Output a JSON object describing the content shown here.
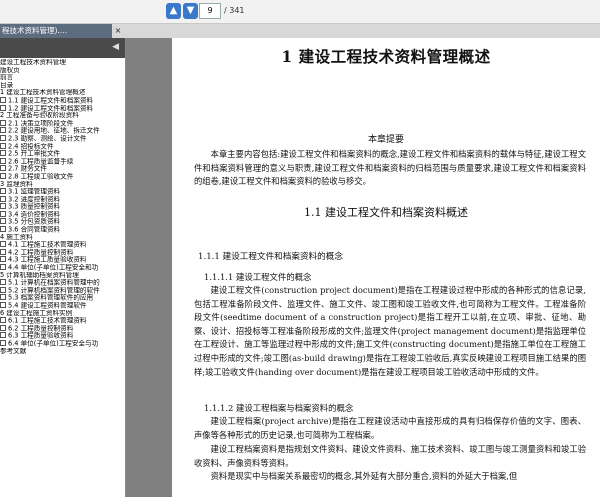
{
  "toolbar": {
    "page_current": "9",
    "page_total": "/ 341",
    "prev_icon": "arrow-up-icon",
    "next_icon": "arrow-down-icon"
  },
  "tab": {
    "title": "程技术资料管理)....",
    "close": "×"
  },
  "sidebar": {
    "toggle": "◀",
    "outline": [
      {
        "label": "建设工程技术资料管理",
        "box": false
      },
      {
        "label": "版权页",
        "box": false
      },
      {
        "label": "前言",
        "box": false
      },
      {
        "label": "目录",
        "box": false
      },
      {
        "label": "1  建设工程技术资料管理概述",
        "box": false
      },
      {
        "label": "1.1  建设工程文件和档案资料",
        "box": true
      },
      {
        "label": "1.2  建设工程文件和档案资料",
        "box": true
      },
      {
        "label": "2  工程准备与验收阶段资料",
        "box": false
      },
      {
        "label": "2.1  决策立项阶段文件",
        "box": true
      },
      {
        "label": "2.2  建设用地、征地、拆迁文件",
        "box": true
      },
      {
        "label": "2.3  勘察、测绘、设计文件",
        "box": true
      },
      {
        "label": "2.4  招投标文件",
        "box": true
      },
      {
        "label": "2.5  开工审批文件",
        "box": true
      },
      {
        "label": "2.6  工程质量监督手续",
        "box": true
      },
      {
        "label": "2.7  财务文件",
        "box": true
      },
      {
        "label": "2.8  工程竣工验收文件",
        "box": true
      },
      {
        "label": "3  监理资料",
        "box": false
      },
      {
        "label": "3.1  监理管理资料",
        "box": true
      },
      {
        "label": "3.2  进度控制资料",
        "box": true
      },
      {
        "label": "3.3  质量控制资料",
        "box": true
      },
      {
        "label": "3.4  造价控制资料",
        "box": true
      },
      {
        "label": "3.5  分包资质资料",
        "box": true
      },
      {
        "label": "3.6  合同管理资料",
        "box": true
      },
      {
        "label": "4  施工资料",
        "box": false
      },
      {
        "label": "4.1  工程施工技术管理资料",
        "box": true
      },
      {
        "label": "4.2  工程质量控制资料",
        "box": true
      },
      {
        "label": "4.3  工程施工质量验收资料",
        "box": true
      },
      {
        "label": "4.4  单位(子单位)工程安全和功",
        "box": true
      },
      {
        "label": "5  计算机辅助档案资料管理",
        "box": false
      },
      {
        "label": "5.1  计算机在档案资料管理中的",
        "box": true
      },
      {
        "label": "5.2  计算机档案资料管理的软件",
        "box": true
      },
      {
        "label": "5.3  档案资料管理软件的应用",
        "box": true
      },
      {
        "label": "5.4  建设工程资料管理软件",
        "box": true
      },
      {
        "label": "6  建设工程施工资料实例",
        "box": false
      },
      {
        "label": "6.1  工程施工技术管理资料",
        "box": true
      },
      {
        "label": "6.2  工程质量控制资料",
        "box": true
      },
      {
        "label": "6.3  工程质量验收资料",
        "box": true
      },
      {
        "label": "6.4  单位(子单位)工程安全与功",
        "box": true
      },
      {
        "label": "参考文献",
        "box": false
      }
    ]
  },
  "document": {
    "chapter_title": "1    建设工程技术资料管理概述",
    "abstract_title": "本章提要",
    "abstract": "本章主要内容包括:建设工程文件和档案资料的概念,建设工程文件和档案资料的载体与特征,建设工程文件和档案资料管理的意义与职责,建设工程文件和档案资料的归档范围与质量要求,建设工程文件和档案资料的组卷,建设工程文件和档案资料的验收与移交。",
    "section_1_1": "1.1    建设工程文件和档案资料概述",
    "section_1_1_1": "1.1.1    建设工程文件和档案资料的概念",
    "section_1_1_1_1": "1.1.1.1    建设工程文件的概念",
    "para_1": "建设工程文件(construction project document)是指在工程建设过程中形成的各种形式的信息记录,包括工程准备阶段文件、监理文件、施工文件、竣工图和竣工验收文件,也可简称为工程文件。工程准备阶段文件(seedtime document of a construction project)是指工程开工以前,在立项、审批、征地、勘察、设计、招投标等工程准备阶段形成的文件;监理文件(project management document)是指监理单位在工程设计、施工等监理过程中形成的文件;施工文件(constructing document)是指施工单位在工程施工过程中形成的文件;竣工图(as-build drawing)是指在工程竣工验收后,真实反映建设工程项目施工结果的图样;竣工验收文件(handing over document)是指在建设工程项目竣工验收活动中形成的文件。",
    "section_1_1_1_2": "1.1.1.2    建设工程档案与档案资料的概念",
    "para_2": "建设工程档案(project archive)是指在工程建设活动中直接形成的具有归档保存价值的文字、图表、声像等各种形式的历史记录,也可简称为工程档案。",
    "para_3": "建设工程档案资料是指规划文件资料、建设文件资料、施工技术资料、竣工图与竣工测量资料和竣工验收资料、声像资料等资料。",
    "para_4": "资料是现实中与档案关系最密切的概念,其外延有大部分重合,资料的外延大于档案,但"
  }
}
